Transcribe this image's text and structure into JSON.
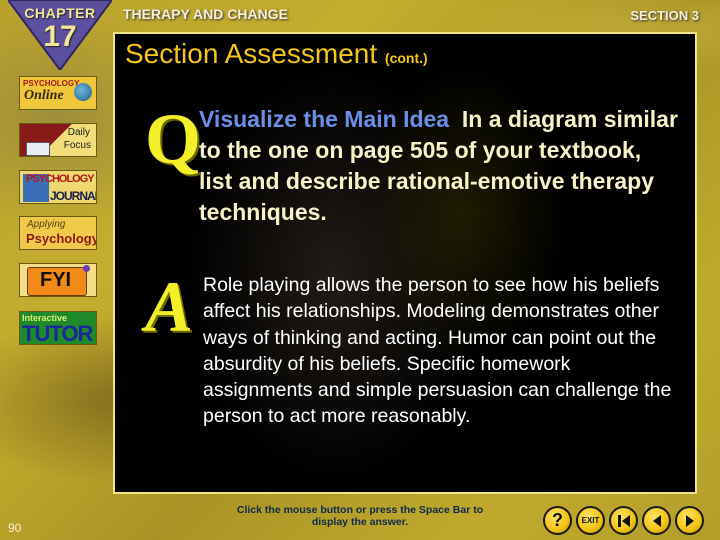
{
  "header": {
    "chapter_label": "CHAPTER",
    "chapter_number": "17",
    "title": "THERAPY AND CHANGE",
    "section": "SECTION 3"
  },
  "slide": {
    "title": "Section Assessment",
    "title_suffix": "(cont.)",
    "question_letter": "Q",
    "question_heading": "Visualize the Main Idea",
    "question_body": "In a diagram similar to the one on page 505 of your textbook, list and describe rational-emotive therapy techniques.",
    "answer_letter": "A",
    "answer_body": "Role playing allows the person to see how his beliefs affect his relationships. Modeling demonstrates other ways of thinking and acting. Humor can point out the absurdity of his beliefs. Specific homework assignments and simple persuasion can challenge the person to act more reasonably."
  },
  "sidebar": {
    "online": {
      "line1": "PSYCHOLOGY",
      "line2": "Online"
    },
    "daily_focus": {
      "line1": "Daily",
      "line2": "Focus"
    },
    "journal": {
      "line1": "PSYCHOLOGY",
      "line2": "JOURNAL"
    },
    "applying": {
      "line1": "Applying",
      "line2": "Psychology"
    },
    "fyi": {
      "label": "FYI"
    },
    "tutor": {
      "line1": "Interactive",
      "line2": "TUTOR"
    }
  },
  "footer": {
    "page_number": "90",
    "instructions": "Click the mouse button or press the Space Bar to display the answer.",
    "buttons": {
      "help": "?",
      "exit": "EXIT"
    }
  },
  "colors": {
    "title": "#f5c518",
    "question_heading": "#6b8fe8",
    "question_text": "#f7f3c6",
    "answer_text": "#ffffff",
    "qa_letter": "#f4ef2a",
    "panel_border": "#f0e48a",
    "chapter_badge": "#5b4f9e"
  }
}
